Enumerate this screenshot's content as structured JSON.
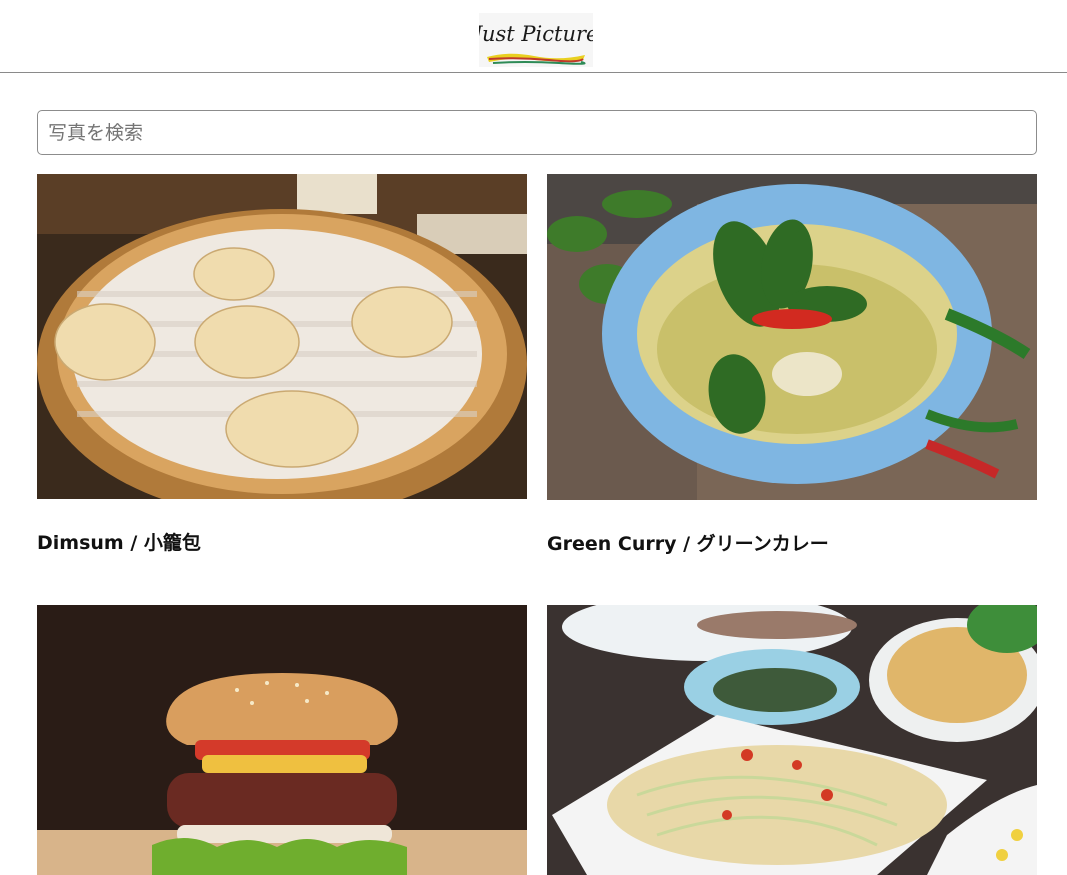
{
  "header": {
    "logo_text": "Just Picture"
  },
  "search": {
    "placeholder": "写真を検索",
    "value": ""
  },
  "photos": [
    {
      "title": "Dimsum / 小籠包",
      "icon": "dimsum-photo"
    },
    {
      "title": "Green Curry / グリーンカレー",
      "icon": "green-curry-photo"
    },
    {
      "title": "",
      "icon": "burger-photo"
    },
    {
      "title": "",
      "icon": "papaya-salad-photo"
    }
  ]
}
